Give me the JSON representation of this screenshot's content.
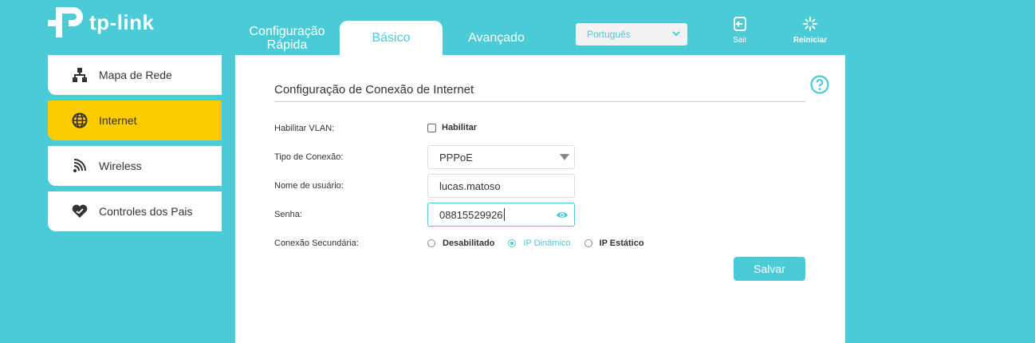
{
  "brand": {
    "logo_text": "tp-link"
  },
  "tabs": [
    {
      "line1": "Configuração",
      "line2": "Rápida"
    },
    {
      "label": "Básico"
    },
    {
      "label": "Avançado"
    }
  ],
  "language": {
    "selected": "Português"
  },
  "top_buttons": {
    "logout": "Sair",
    "reboot": "Reiniciar"
  },
  "sidebar": {
    "items": [
      {
        "label": "Mapa de Rede",
        "icon": "network-map-icon"
      },
      {
        "label": "Internet",
        "icon": "globe-icon",
        "active": true
      },
      {
        "label": "Wireless",
        "icon": "wireless-icon"
      },
      {
        "label": "Controles dos Pais",
        "icon": "parental-heart-icon"
      }
    ]
  },
  "section": {
    "title": "Configuração de Conexão de Internet"
  },
  "form": {
    "vlan_label": "Habilitar VLAN:",
    "vlan_option": "Habilitar",
    "conn_type_label": "Tipo de Conexão:",
    "conn_type_value": "PPPoE",
    "username_label": "Nome de usuário:",
    "username_value": "lucas.matoso",
    "password_label": "Senha:",
    "password_value": "08815529926",
    "secondary_label": "Conexão Secundária:",
    "secondary_options": [
      "Desabilitado",
      "IP Dinâmico",
      "IP Estático"
    ],
    "secondary_selected": "IP Dinâmico",
    "save_label": "Salvar"
  },
  "colors": {
    "accent": "#4acbd6",
    "active_item": "#fccb00"
  }
}
